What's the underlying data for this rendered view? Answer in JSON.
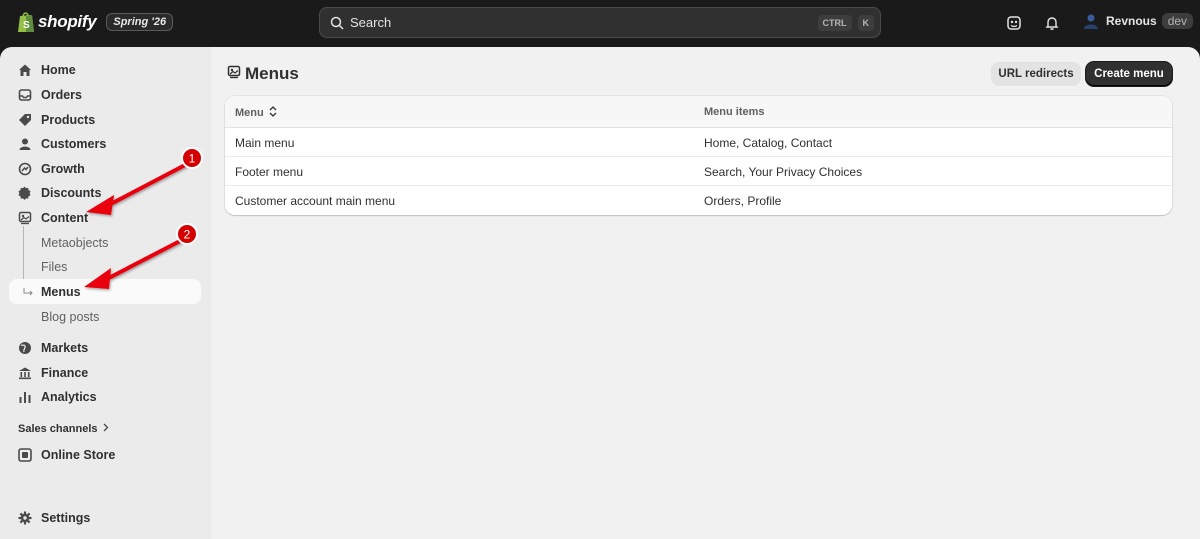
{
  "topbar": {
    "logo_text": "shopify",
    "edition_badge": "Spring '26",
    "search_placeholder": "Search",
    "shortcut_key1": "CTRL",
    "shortcut_key2": "K",
    "user_name": "Revnous",
    "user_badge": "dev"
  },
  "sidebar": {
    "items": [
      {
        "label": "Home",
        "icon": "home-icon"
      },
      {
        "label": "Orders",
        "icon": "inbox-icon"
      },
      {
        "label": "Products",
        "icon": "tag-icon"
      },
      {
        "label": "Customers",
        "icon": "person-icon"
      },
      {
        "label": "Growth",
        "icon": "growth-icon"
      },
      {
        "label": "Discounts",
        "icon": "discount-icon"
      },
      {
        "label": "Content",
        "icon": "content-icon"
      }
    ],
    "content_sub": [
      {
        "label": "Metaobjects"
      },
      {
        "label": "Files"
      },
      {
        "label": "Menus"
      },
      {
        "label": "Blog posts"
      }
    ],
    "items2": [
      {
        "label": "Markets",
        "icon": "globe-icon"
      },
      {
        "label": "Finance",
        "icon": "bank-icon"
      },
      {
        "label": "Analytics",
        "icon": "chart-icon"
      }
    ],
    "sales_channels_label": "Sales channels",
    "online_store_label": "Online Store",
    "settings_label": "Settings"
  },
  "main": {
    "title": "Menus",
    "url_redirects_label": "URL redirects",
    "create_menu_label": "Create menu",
    "columns": [
      "Menu",
      "Menu items"
    ],
    "rows": [
      {
        "menu": "Main menu",
        "items": "Home, Catalog, Contact"
      },
      {
        "menu": "Footer menu",
        "items": "Search, Your Privacy Choices"
      },
      {
        "menu": "Customer account main menu",
        "items": "Orders, Profile"
      }
    ]
  },
  "annotations": {
    "badge1": "1",
    "badge2": "2",
    "arrow_color": "#e8000b"
  },
  "colors": {
    "topbar_bg": "#1a1a1a",
    "sidebar_bg": "#ebebeb",
    "main_bg": "#f1f1f1",
    "primary_button": "#303030"
  }
}
